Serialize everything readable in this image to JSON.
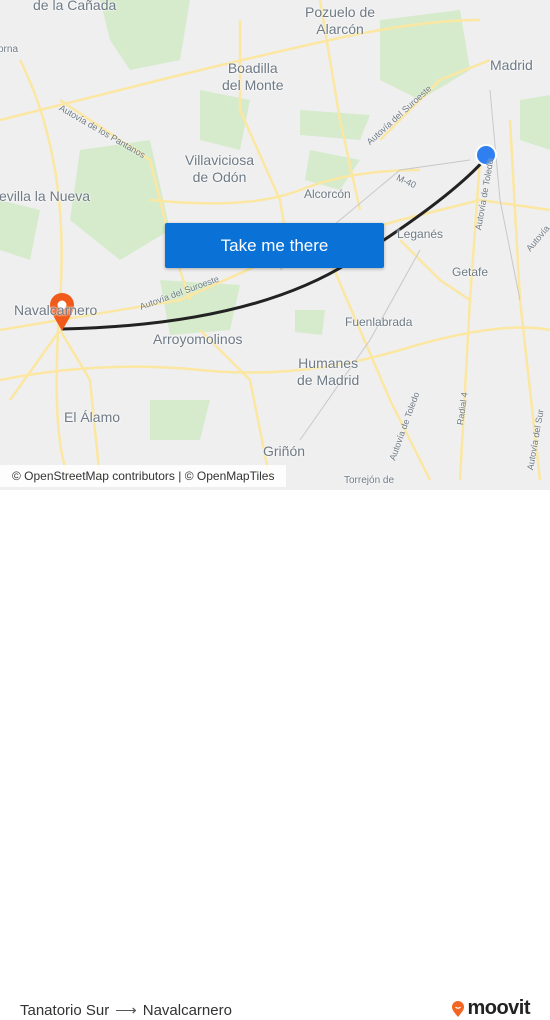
{
  "map": {
    "places": [
      "de la Cañada",
      "Pozuelo de\nAlarcón",
      "Madrid",
      "Boadilla\ndel Monte",
      "Villaviciosa\nde Odón",
      "Alcorcón",
      "evilla la Nueva",
      "Leganés",
      "Getafe",
      "Navalcarnero",
      "Fuenlabrada",
      "Arroyomolinos",
      "Humanes\nde Madrid",
      "El Álamo",
      "Griñón",
      "Torrejón de",
      "orna"
    ],
    "roads": [
      "Autovía de los Pantanos",
      "Autovía del Suroeste",
      "M-40",
      "Autovía de Toledo",
      "Autovía del Suroeste",
      "Autovía de Toledo",
      "Radial 4",
      "Autovía del Sur",
      "Autovía"
    ],
    "route_color": "#222222",
    "origin_color": "#2f7ff0",
    "destination_color": "#f05a1a"
  },
  "cta": {
    "label": "Take me there"
  },
  "attribution": "© OpenStreetMap contributors | © OpenMapTiles",
  "footer": {
    "origin": "Tanatorio Sur",
    "arrow": "⟶",
    "destination": "Navalcarnero",
    "brand": "moovit",
    "brand_color": "#f26522"
  }
}
